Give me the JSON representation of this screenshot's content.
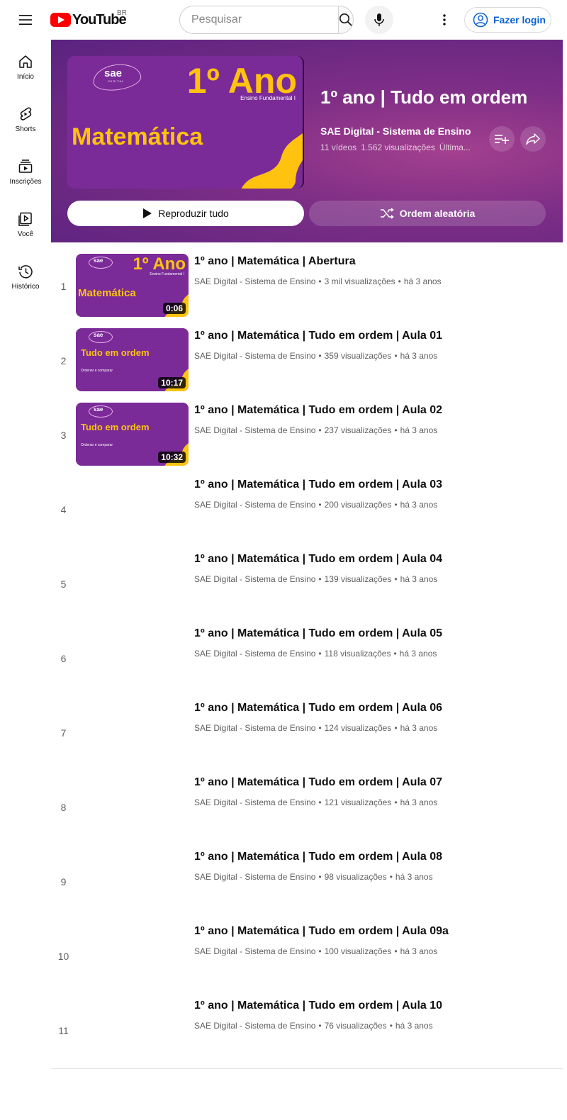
{
  "topbar": {
    "logo_text": "YouTube",
    "country": "BR",
    "search_placeholder": "Pesquisar",
    "login_label": "Fazer login"
  },
  "sidenav": {
    "items": [
      {
        "label": "Início",
        "icon": "home-icon"
      },
      {
        "label": "Shorts",
        "icon": "shorts-icon"
      },
      {
        "label": "Inscrições",
        "icon": "subscriptions-icon"
      },
      {
        "label": "Você",
        "icon": "you-icon"
      },
      {
        "label": "Histórico",
        "icon": "history-icon"
      }
    ]
  },
  "playlist": {
    "title": "1º ano | Tudo em ordem",
    "owner": "SAE Digital - Sistema de Ensino",
    "video_count": "11 vídeos",
    "views": "1.562 visualizações",
    "updated": "Última...",
    "play_all_label": "Reproduzir tudo",
    "shuffle_label": "Ordem aleatória",
    "cover": {
      "brand": "sae",
      "brand_sub": "DIGITAL",
      "year": "1º Ano",
      "level": "Ensino Fundamental I",
      "subject": "Matemática"
    }
  },
  "colors": {
    "header_purple": "#7e2e86",
    "cover_purple": "#7a2b98",
    "cover_yellow": "#ffc20e",
    "brand_red": "#ff0000",
    "link_blue": "#065fd4"
  },
  "videos": [
    {
      "index": "1",
      "title": "1º ano | Matemática | Abertura",
      "channel": "SAE Digital - Sistema de Ensino",
      "views": "3 mil visualizações",
      "age": "há 3 anos",
      "duration": "0:06",
      "thumb": {
        "brand": "sae",
        "year": "1º Ano",
        "level": "Ensino Fundamental I",
        "subject": "Matemática"
      }
    },
    {
      "index": "2",
      "title": "1º ano | Matemática | Tudo em ordem | Aula 01",
      "channel": "SAE Digital - Sistema de Ensino",
      "views": "359 visualizações",
      "age": "há 3 anos",
      "duration": "10:17",
      "thumb": {
        "brand": "sae",
        "topic": "Tudo em ordem",
        "sub": "Ordenar e comparar"
      }
    },
    {
      "index": "3",
      "title": "1º ano | Matemática | Tudo em ordem | Aula 02",
      "channel": "SAE Digital - Sistema de Ensino",
      "views": "237 visualizações",
      "age": "há 3 anos",
      "duration": "10:32",
      "thumb": {
        "brand": "sae",
        "topic": "Tudo em ordem",
        "sub": "Ordenar e comparar"
      }
    },
    {
      "index": "4",
      "title": "1º ano | Matemática | Tudo em ordem | Aula 03",
      "channel": "SAE Digital - Sistema de Ensino",
      "views": "200 visualizações",
      "age": "há 3 anos"
    },
    {
      "index": "5",
      "title": "1º ano | Matemática | Tudo em ordem | Aula 04",
      "channel": "SAE Digital - Sistema de Ensino",
      "views": "139 visualizações",
      "age": "há 3 anos"
    },
    {
      "index": "6",
      "title": "1º ano | Matemática | Tudo em ordem | Aula 05",
      "channel": "SAE Digital - Sistema de Ensino",
      "views": "118 visualizações",
      "age": "há 3 anos"
    },
    {
      "index": "7",
      "title": "1º ano | Matemática | Tudo em ordem | Aula 06",
      "channel": "SAE Digital - Sistema de Ensino",
      "views": "124 visualizações",
      "age": "há 3 anos"
    },
    {
      "index": "8",
      "title": "1º ano | Matemática | Tudo em ordem | Aula 07",
      "channel": "SAE Digital - Sistema de Ensino",
      "views": "121 visualizações",
      "age": "há 3 anos"
    },
    {
      "index": "9",
      "title": "1º ano | Matemática | Tudo em ordem | Aula 08",
      "channel": "SAE Digital - Sistema de Ensino",
      "views": "98 visualizações",
      "age": "há 3 anos"
    },
    {
      "index": "10",
      "title": "1º ano | Matemática | Tudo em ordem | Aula 09a",
      "channel": "SAE Digital - Sistema de Ensino",
      "views": "100 visualizações",
      "age": "há 3 anos"
    },
    {
      "index": "11",
      "title": "1º ano | Matemática | Tudo em ordem | Aula 10",
      "channel": "SAE Digital - Sistema de Ensino",
      "views": "76 visualizações",
      "age": "há 3 anos"
    }
  ]
}
